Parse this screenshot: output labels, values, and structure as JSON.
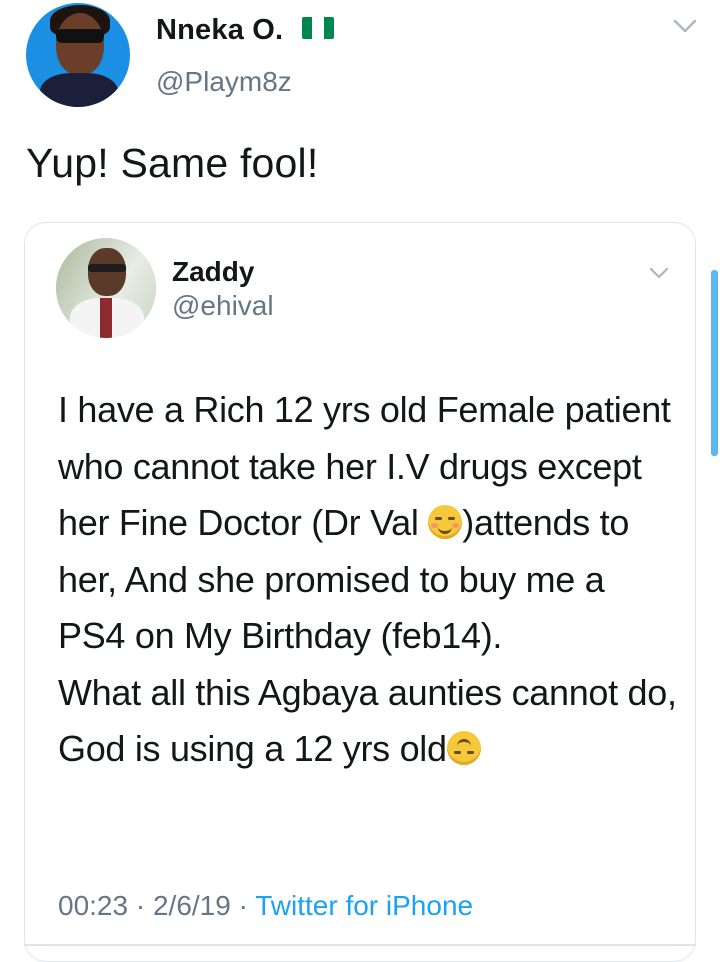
{
  "tweet": {
    "author_name": "Nneka O.",
    "flag_icon": "nigeria-flag-icon",
    "handle": "@Playm8z",
    "text": "Yup! Same fool!"
  },
  "quoted_tweet": {
    "author_name": "Zaddy",
    "handle": "@ehival",
    "paragraph_1_part_a": "I have a Rich 12 yrs old Female patient who cannot take her I.V drugs except her Fine Doctor (Dr Val ",
    "paragraph_1_part_b": ")attends to her, And she promised to buy me a PS4 on My Birthday (feb14).",
    "paragraph_2": "What all this Agbaya aunties cannot do, God is using a 12 yrs old",
    "emoji_1": "smiling-face-with-blush-icon",
    "emoji_2": "upside-down-face-icon",
    "time": "00:23",
    "date": "2/6/19",
    "separator": "·",
    "source": "Twitter for iPhone"
  },
  "colors": {
    "text": "#14171a",
    "secondary": "#657786",
    "link": "#1da1f2",
    "border": "#dfe5ea"
  }
}
